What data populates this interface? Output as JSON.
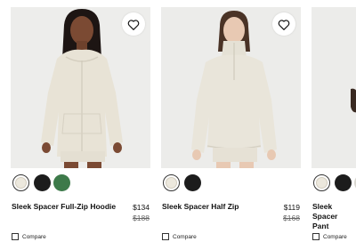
{
  "products": [
    {
      "name": "Sleek Spacer Full-Zip Hoodie",
      "price": "$134",
      "original_price": "$188",
      "compare_label": "Compare",
      "swatches": [
        "#ece8dd",
        "#1c1c1c",
        "#3d7a4a"
      ],
      "selected_swatch": 0,
      "favorite_icon": "heart-outline-icon"
    },
    {
      "name": "Sleek Spacer Half Zip",
      "price": "$119",
      "original_price": "$168",
      "compare_label": "Compare",
      "swatches": [
        "#ece8dd",
        "#1c1c1c"
      ],
      "selected_swatch": 0,
      "favorite_icon": "heart-outline-icon"
    },
    {
      "name": "Sleek Spacer Pant",
      "compare_label": "Compare",
      "swatches": [
        "#ece8dd",
        "#1c1c1c",
        "#d8d6cf"
      ],
      "selected_swatch": 0
    }
  ]
}
